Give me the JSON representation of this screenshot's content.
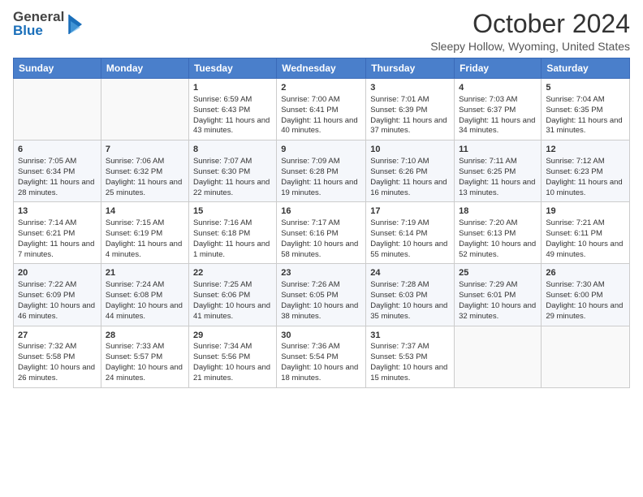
{
  "header": {
    "logo_general": "General",
    "logo_blue": "Blue",
    "month_title": "October 2024",
    "location": "Sleepy Hollow, Wyoming, United States"
  },
  "weekdays": [
    "Sunday",
    "Monday",
    "Tuesday",
    "Wednesday",
    "Thursday",
    "Friday",
    "Saturday"
  ],
  "weeks": [
    [
      {
        "day": "",
        "sunrise": "",
        "sunset": "",
        "daylight": ""
      },
      {
        "day": "",
        "sunrise": "",
        "sunset": "",
        "daylight": ""
      },
      {
        "day": "1",
        "sunrise": "Sunrise: 6:59 AM",
        "sunset": "Sunset: 6:43 PM",
        "daylight": "Daylight: 11 hours and 43 minutes."
      },
      {
        "day": "2",
        "sunrise": "Sunrise: 7:00 AM",
        "sunset": "Sunset: 6:41 PM",
        "daylight": "Daylight: 11 hours and 40 minutes."
      },
      {
        "day": "3",
        "sunrise": "Sunrise: 7:01 AM",
        "sunset": "Sunset: 6:39 PM",
        "daylight": "Daylight: 11 hours and 37 minutes."
      },
      {
        "day": "4",
        "sunrise": "Sunrise: 7:03 AM",
        "sunset": "Sunset: 6:37 PM",
        "daylight": "Daylight: 11 hours and 34 minutes."
      },
      {
        "day": "5",
        "sunrise": "Sunrise: 7:04 AM",
        "sunset": "Sunset: 6:35 PM",
        "daylight": "Daylight: 11 hours and 31 minutes."
      }
    ],
    [
      {
        "day": "6",
        "sunrise": "Sunrise: 7:05 AM",
        "sunset": "Sunset: 6:34 PM",
        "daylight": "Daylight: 11 hours and 28 minutes."
      },
      {
        "day": "7",
        "sunrise": "Sunrise: 7:06 AM",
        "sunset": "Sunset: 6:32 PM",
        "daylight": "Daylight: 11 hours and 25 minutes."
      },
      {
        "day": "8",
        "sunrise": "Sunrise: 7:07 AM",
        "sunset": "Sunset: 6:30 PM",
        "daylight": "Daylight: 11 hours and 22 minutes."
      },
      {
        "day": "9",
        "sunrise": "Sunrise: 7:09 AM",
        "sunset": "Sunset: 6:28 PM",
        "daylight": "Daylight: 11 hours and 19 minutes."
      },
      {
        "day": "10",
        "sunrise": "Sunrise: 7:10 AM",
        "sunset": "Sunset: 6:26 PM",
        "daylight": "Daylight: 11 hours and 16 minutes."
      },
      {
        "day": "11",
        "sunrise": "Sunrise: 7:11 AM",
        "sunset": "Sunset: 6:25 PM",
        "daylight": "Daylight: 11 hours and 13 minutes."
      },
      {
        "day": "12",
        "sunrise": "Sunrise: 7:12 AM",
        "sunset": "Sunset: 6:23 PM",
        "daylight": "Daylight: 11 hours and 10 minutes."
      }
    ],
    [
      {
        "day": "13",
        "sunrise": "Sunrise: 7:14 AM",
        "sunset": "Sunset: 6:21 PM",
        "daylight": "Daylight: 11 hours and 7 minutes."
      },
      {
        "day": "14",
        "sunrise": "Sunrise: 7:15 AM",
        "sunset": "Sunset: 6:19 PM",
        "daylight": "Daylight: 11 hours and 4 minutes."
      },
      {
        "day": "15",
        "sunrise": "Sunrise: 7:16 AM",
        "sunset": "Sunset: 6:18 PM",
        "daylight": "Daylight: 11 hours and 1 minute."
      },
      {
        "day": "16",
        "sunrise": "Sunrise: 7:17 AM",
        "sunset": "Sunset: 6:16 PM",
        "daylight": "Daylight: 10 hours and 58 minutes."
      },
      {
        "day": "17",
        "sunrise": "Sunrise: 7:19 AM",
        "sunset": "Sunset: 6:14 PM",
        "daylight": "Daylight: 10 hours and 55 minutes."
      },
      {
        "day": "18",
        "sunrise": "Sunrise: 7:20 AM",
        "sunset": "Sunset: 6:13 PM",
        "daylight": "Daylight: 10 hours and 52 minutes."
      },
      {
        "day": "19",
        "sunrise": "Sunrise: 7:21 AM",
        "sunset": "Sunset: 6:11 PM",
        "daylight": "Daylight: 10 hours and 49 minutes."
      }
    ],
    [
      {
        "day": "20",
        "sunrise": "Sunrise: 7:22 AM",
        "sunset": "Sunset: 6:09 PM",
        "daylight": "Daylight: 10 hours and 46 minutes."
      },
      {
        "day": "21",
        "sunrise": "Sunrise: 7:24 AM",
        "sunset": "Sunset: 6:08 PM",
        "daylight": "Daylight: 10 hours and 44 minutes."
      },
      {
        "day": "22",
        "sunrise": "Sunrise: 7:25 AM",
        "sunset": "Sunset: 6:06 PM",
        "daylight": "Daylight: 10 hours and 41 minutes."
      },
      {
        "day": "23",
        "sunrise": "Sunrise: 7:26 AM",
        "sunset": "Sunset: 6:05 PM",
        "daylight": "Daylight: 10 hours and 38 minutes."
      },
      {
        "day": "24",
        "sunrise": "Sunrise: 7:28 AM",
        "sunset": "Sunset: 6:03 PM",
        "daylight": "Daylight: 10 hours and 35 minutes."
      },
      {
        "day": "25",
        "sunrise": "Sunrise: 7:29 AM",
        "sunset": "Sunset: 6:01 PM",
        "daylight": "Daylight: 10 hours and 32 minutes."
      },
      {
        "day": "26",
        "sunrise": "Sunrise: 7:30 AM",
        "sunset": "Sunset: 6:00 PM",
        "daylight": "Daylight: 10 hours and 29 minutes."
      }
    ],
    [
      {
        "day": "27",
        "sunrise": "Sunrise: 7:32 AM",
        "sunset": "Sunset: 5:58 PM",
        "daylight": "Daylight: 10 hours and 26 minutes."
      },
      {
        "day": "28",
        "sunrise": "Sunrise: 7:33 AM",
        "sunset": "Sunset: 5:57 PM",
        "daylight": "Daylight: 10 hours and 24 minutes."
      },
      {
        "day": "29",
        "sunrise": "Sunrise: 7:34 AM",
        "sunset": "Sunset: 5:56 PM",
        "daylight": "Daylight: 10 hours and 21 minutes."
      },
      {
        "day": "30",
        "sunrise": "Sunrise: 7:36 AM",
        "sunset": "Sunset: 5:54 PM",
        "daylight": "Daylight: 10 hours and 18 minutes."
      },
      {
        "day": "31",
        "sunrise": "Sunrise: 7:37 AM",
        "sunset": "Sunset: 5:53 PM",
        "daylight": "Daylight: 10 hours and 15 minutes."
      },
      {
        "day": "",
        "sunrise": "",
        "sunset": "",
        "daylight": ""
      },
      {
        "day": "",
        "sunrise": "",
        "sunset": "",
        "daylight": ""
      }
    ]
  ]
}
